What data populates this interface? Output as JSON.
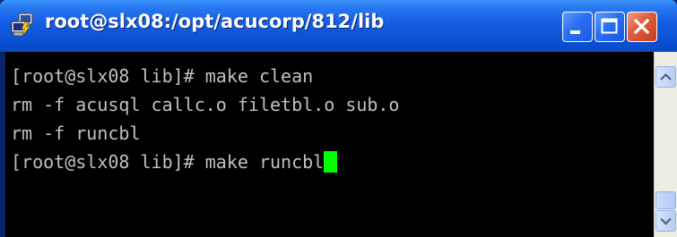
{
  "window": {
    "title": "root@slx08:/opt/acucorp/812/lib",
    "icon": "putty-terminal-icon"
  },
  "controls": {
    "minimize_icon": "minimize-icon",
    "maximize_icon": "maximize-icon",
    "close_icon": "close-icon"
  },
  "terminal": {
    "lines": [
      "[root@slx08 lib]# make clean",
      "rm -f acusql callc.o filetbl.o sub.o",
      "rm -f runcbl",
      "[root@slx08 lib]# make runcbl"
    ],
    "cursor_color": "#00ff00",
    "text_color": "#c0c0c0",
    "background": "#000000"
  },
  "scrollbar": {
    "up_icon": "scroll-up-arrow-icon",
    "down_icon": "scroll-down-arrow-icon"
  },
  "colors": {
    "titlebar": "#0a4fd0",
    "close_button": "#e06040"
  }
}
